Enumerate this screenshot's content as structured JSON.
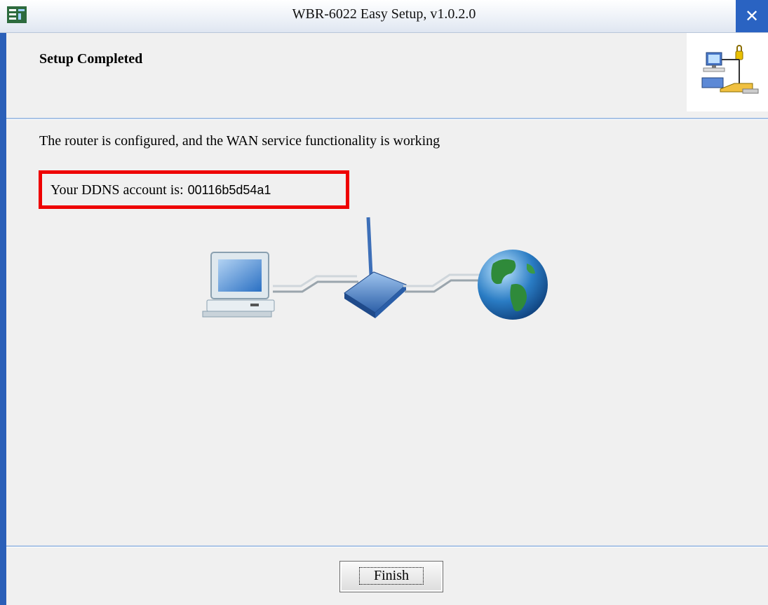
{
  "window": {
    "title": "WBR-6022 Easy Setup, v1.0.2.0",
    "close_glyph": "✕",
    "accent_color": "#2a63c2"
  },
  "header": {
    "title": "Setup Completed",
    "icon": "network-computers-icon"
  },
  "content": {
    "status_message": "The router is configured, and the WAN service functionality is working",
    "ddns_label": "Your DDNS account is:",
    "ddns_account": "00116b5d54a1",
    "highlight_color": "#ee0000",
    "diagram_icons": [
      "computer-icon",
      "wireless-router-icon",
      "globe-icon"
    ]
  },
  "footer": {
    "finish_label": "Finish"
  }
}
